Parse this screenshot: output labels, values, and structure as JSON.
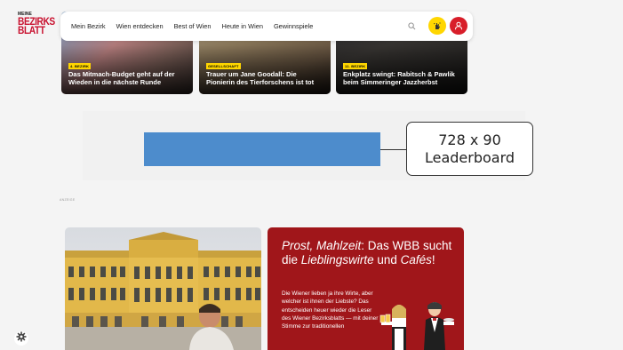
{
  "brand": {
    "logo_small": "MEINE",
    "logo_line1": "BEZIRKS",
    "logo_line2": "BLATT"
  },
  "nav": {
    "items": [
      "Mein Bezirk",
      "Wien entdecken",
      "Best of Wien",
      "Heute in Wien",
      "Gewinnspiele"
    ],
    "icons": {
      "search": "search-icon",
      "tip": "hand-tip-icon",
      "account": "user-icon"
    },
    "colors": {
      "tip_bg": "#ffd600",
      "account_bg": "#d81e2a"
    }
  },
  "cards": [
    {
      "tag": "4. Bezirk",
      "title": "Das Mitmach-Budget geht auf der Wieden in die nächste Runde"
    },
    {
      "tag": "Gesellschaft",
      "title": "Trauer um Jane Goodall: Die Pionierin des Tierforschens ist tot"
    },
    {
      "tag": "11. Bezirk",
      "title": "Enkplatz swingt: Rabitsch & Pawlik beim Simmeringer Jazzherbst"
    }
  ],
  "ad": {
    "size": "728 x 90",
    "type": "Leaderboard",
    "color": "#4d8ccc"
  },
  "anzeige_label": "ANZEIGE",
  "promo": {
    "title_part1": "Prost, Mahlzeit",
    "title_part2": ": Das WBB sucht die ",
    "title_part3": "Lieblingswirte",
    "title_part4": " und ",
    "title_part5": "Cafés",
    "title_part6": "!",
    "text": "Die Wiener lieben ja ihre Wirte, aber welcher ist ihnen der Liebste? Das entscheiden heuer wieder die Leser des Wiener Bezirksblatts — mit deiner Stimme zur traditionellen",
    "bg_color": "#a0161a"
  },
  "cookie": {
    "icon": "gear-icon"
  }
}
